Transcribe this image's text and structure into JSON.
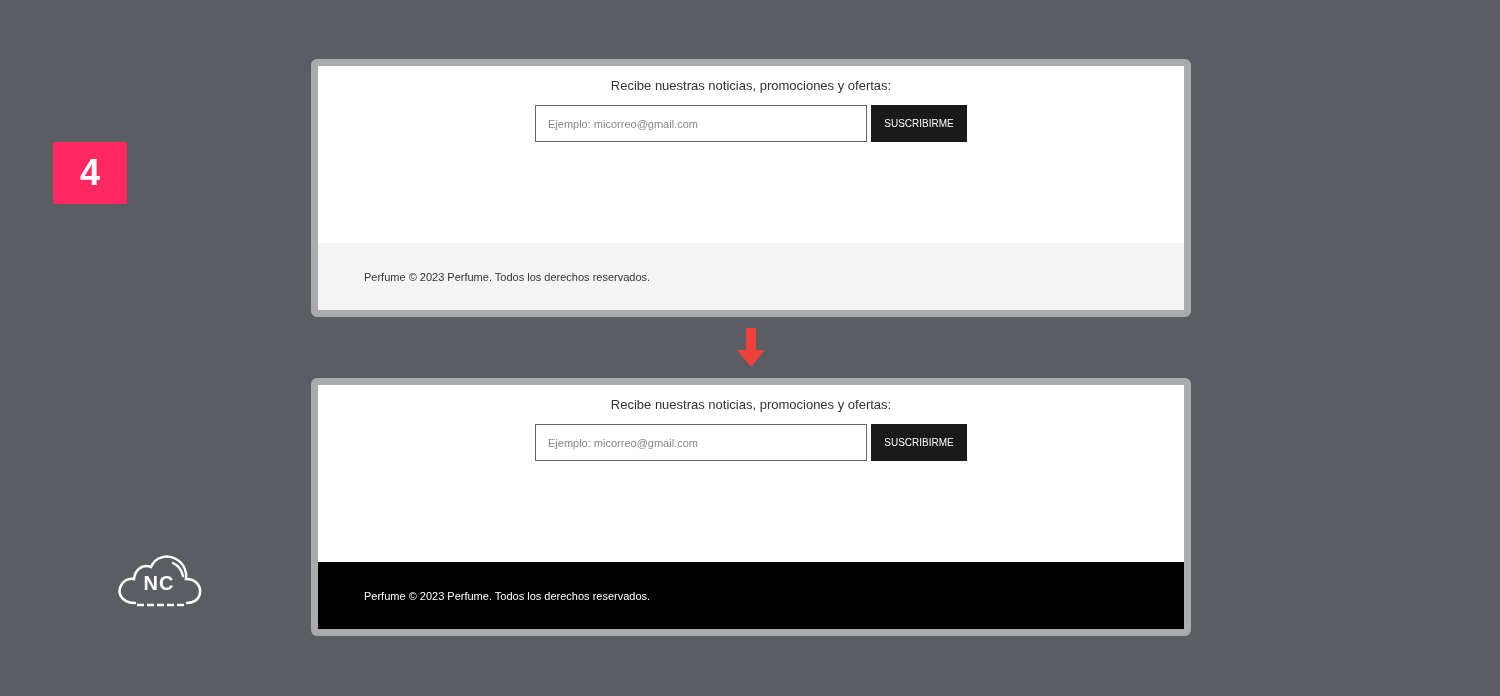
{
  "step_badge": "4",
  "logo": {
    "text": "NC"
  },
  "panels": [
    {
      "kind": "light",
      "heading": "Recibe nuestras noticias, promociones y ofertas:",
      "email_field": {
        "placeholder": "Ejemplo: micorreo@gmail.com"
      },
      "button": "SUSCRIBIRME",
      "footer_text": "Perfume © 2023 Perfume. Todos los derechos reservados."
    },
    {
      "kind": "dark",
      "heading": "Recibe nuestras noticias, promociones y ofertas:",
      "email_field": {
        "placeholder": "Ejemplo: micorreo@gmail.com"
      },
      "button": "SUSCRIBIRME",
      "footer_text": "Perfume © 2023 Perfume. Todos los derechos reservados."
    }
  ]
}
